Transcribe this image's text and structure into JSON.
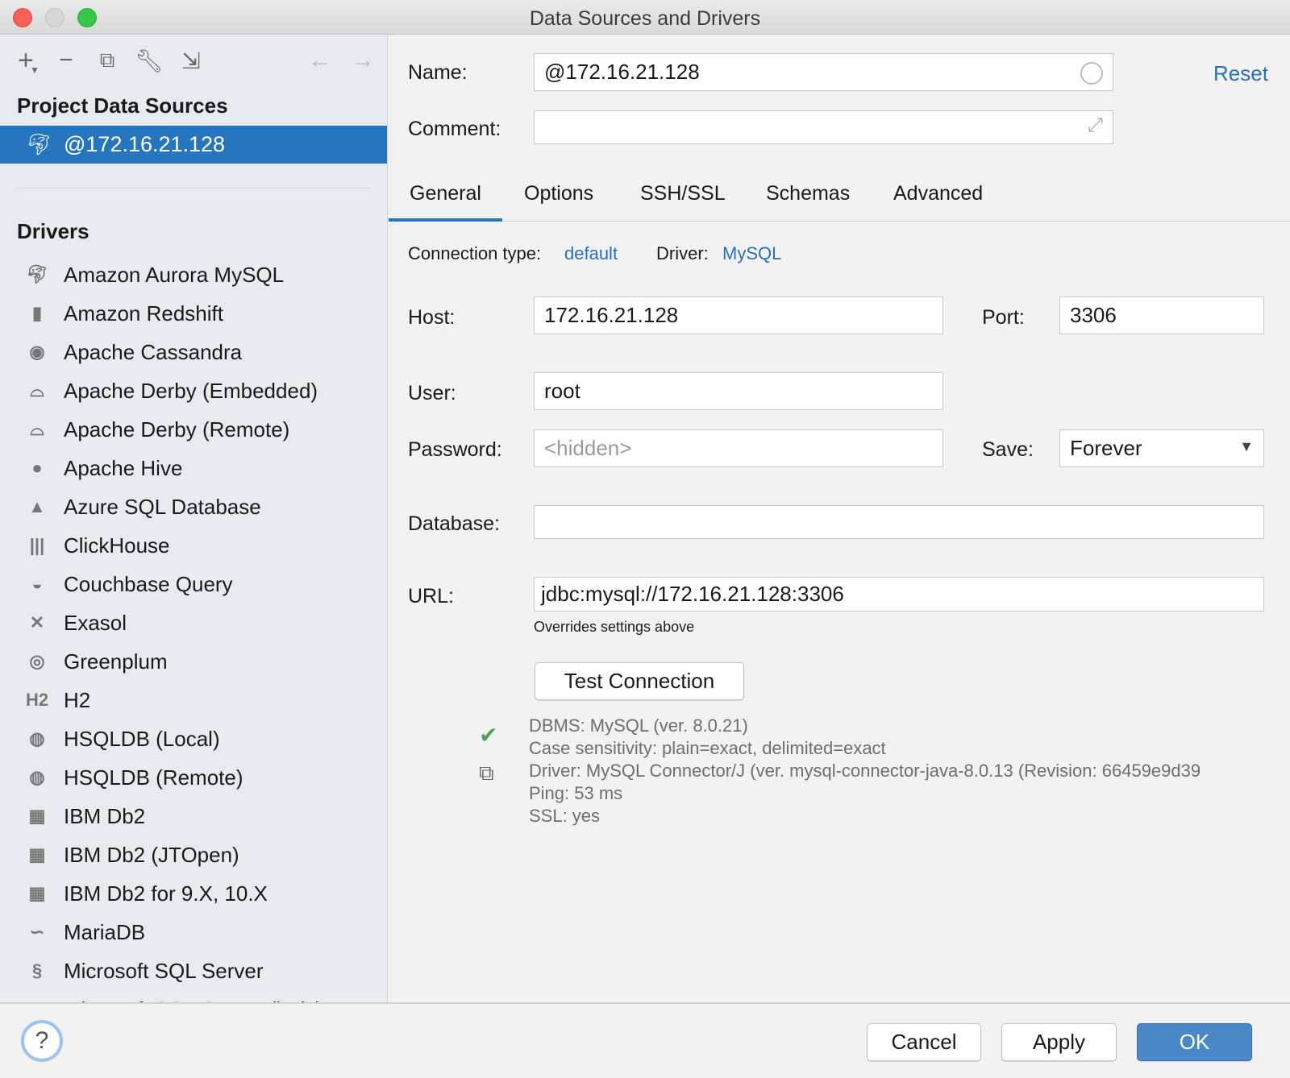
{
  "window": {
    "title": "Data Sources and Drivers"
  },
  "sidebar": {
    "toolbar": [
      "add-icon",
      "remove-icon",
      "duplicate-icon",
      "wrench-icon",
      "import-icon",
      "back-arrow-icon",
      "forward-arrow-icon"
    ],
    "project_heading": "Project Data Sources",
    "selected_source": "@172.16.21.128",
    "drivers_heading": "Drivers",
    "drivers": [
      {
        "label": "Amazon Aurora MySQL",
        "icon": "dolphin-icon"
      },
      {
        "label": "Amazon Redshift",
        "icon": "redshift-icon"
      },
      {
        "label": "Apache Cassandra",
        "icon": "eye-icon"
      },
      {
        "label": "Apache Derby (Embedded)",
        "icon": "hat-icon"
      },
      {
        "label": "Apache Derby (Remote)",
        "icon": "hat-icon"
      },
      {
        "label": "Apache Hive",
        "icon": "bee-icon"
      },
      {
        "label": "Azure SQL Database",
        "icon": "azure-icon"
      },
      {
        "label": "ClickHouse",
        "icon": "bars-icon"
      },
      {
        "label": "Couchbase Query",
        "icon": "couchbase-icon"
      },
      {
        "label": "Exasol",
        "icon": "x-icon"
      },
      {
        "label": "Greenplum",
        "icon": "greenplum-icon"
      },
      {
        "label": "H2",
        "icon": "h2-icon"
      },
      {
        "label": "HSQLDB (Local)",
        "icon": "hsqldb-icon"
      },
      {
        "label": "HSQLDB (Remote)",
        "icon": "hsqldb-icon"
      },
      {
        "label": "IBM Db2",
        "icon": "ibm-icon"
      },
      {
        "label": "IBM Db2 (JTOpen)",
        "icon": "ibm-icon"
      },
      {
        "label": "IBM Db2 for 9.X, 10.X",
        "icon": "ibm-icon"
      },
      {
        "label": "MariaDB",
        "icon": "seal-icon"
      },
      {
        "label": "Microsoft SQL Server",
        "icon": "sqlserver-icon"
      },
      {
        "label": "Microsoft SQL Server (jTds)",
        "icon": "sqlserver-icon"
      }
    ]
  },
  "form": {
    "name_label": "Name:",
    "name_value": "@172.16.21.128",
    "reset": "Reset",
    "comment_label": "Comment:",
    "comment_value": "",
    "tabs": [
      "General",
      "Options",
      "SSH/SSL",
      "Schemas",
      "Advanced"
    ],
    "active_tab": "General",
    "connection_type_label": "Connection type:",
    "connection_type": "default",
    "driver_label": "Driver:",
    "driver": "MySQL",
    "host_label": "Host:",
    "host": "172.16.21.128",
    "port_label": "Port:",
    "port": "3306",
    "user_label": "User:",
    "user": "root",
    "password_label": "Password:",
    "password_placeholder": "<hidden>",
    "save_label": "Save:",
    "save_value": "Forever",
    "database_label": "Database:",
    "database": "",
    "url_label": "URL:",
    "url": "jdbc:mysql://172.16.21.128:3306",
    "url_hint": "Overrides settings above",
    "test_connection": "Test Connection",
    "results": [
      "DBMS: MySQL (ver. 8.0.21)",
      "Case sensitivity: plain=exact, delimited=exact",
      "Driver: MySQL Connector/J (ver. mysql-connector-java-8.0.13 (Revision: 66459e9d39",
      "Ping: 53 ms",
      "SSL: yes"
    ]
  },
  "footer": {
    "help": "?",
    "cancel": "Cancel",
    "apply": "Apply",
    "ok": "OK"
  },
  "colors": {
    "accent": "#2675bf",
    "ok_button": "#4a88c8",
    "success": "#4aa05a"
  }
}
